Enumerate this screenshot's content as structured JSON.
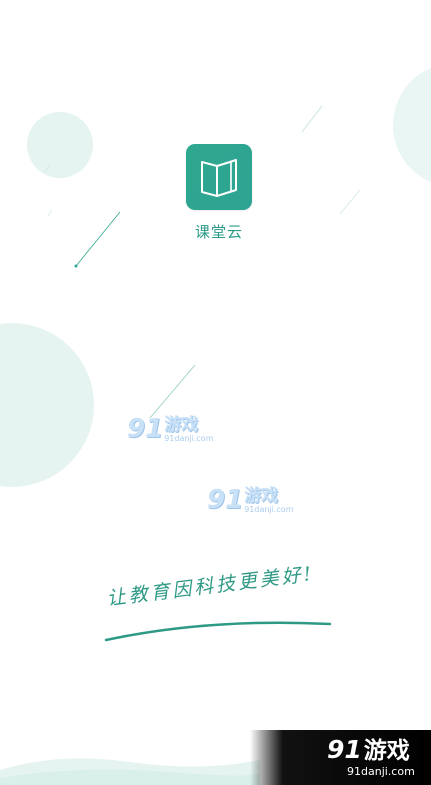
{
  "app": {
    "name": "课堂云",
    "icon": "open-book-icon"
  },
  "slogan": "让教育因科技更美好!",
  "watermarks": [
    {
      "logo": "91",
      "brand": "游戏",
      "url": "91danji.com"
    },
    {
      "logo": "91",
      "brand": "游戏",
      "url": "91danji.com"
    }
  ],
  "corner_badge": {
    "logo": "91",
    "brand": "游戏",
    "url": "91danji.com"
  },
  "colors": {
    "brand_green": "#2fa78e",
    "light_teal": "#e6f4f1",
    "background": "#ffffff"
  }
}
